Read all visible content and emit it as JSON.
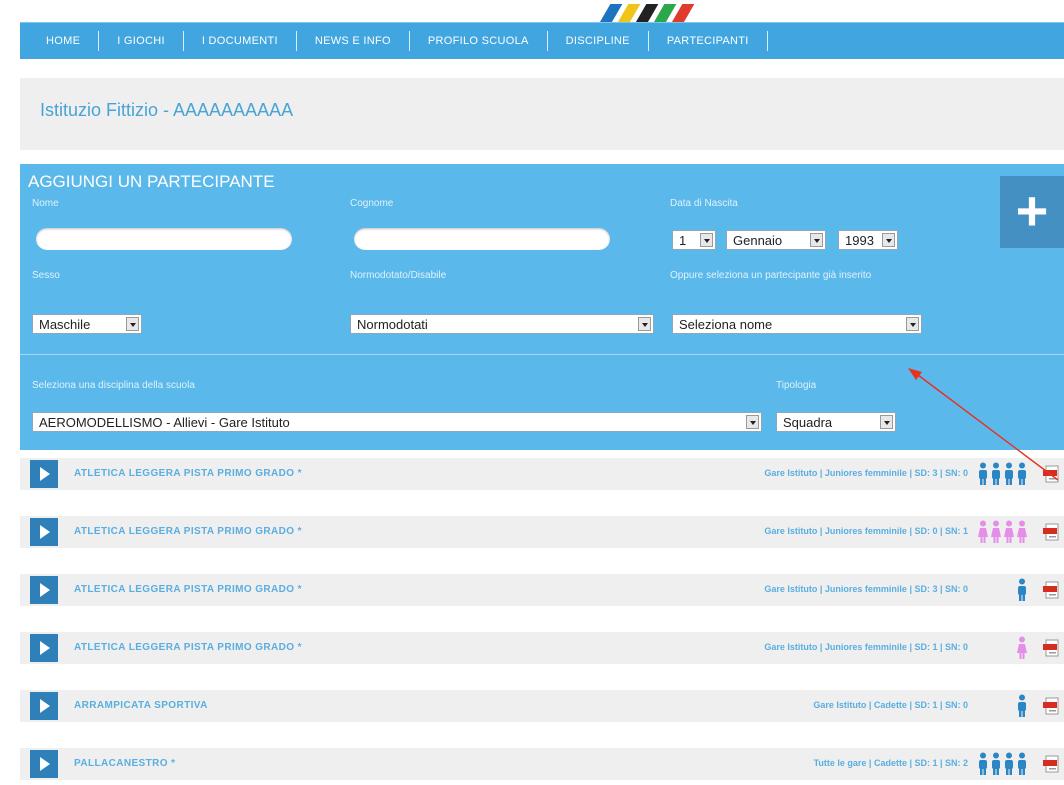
{
  "nav": {
    "items": [
      "HOME",
      "I GIOCHI",
      "I DOCUMENTI",
      "NEWS E INFO",
      "PROFILO SCUOLA",
      "DISCIPLINE",
      "PARTECIPANTI"
    ]
  },
  "school": {
    "title": "Istituzio Fittizio - AAAAAAAAAA"
  },
  "form": {
    "title": "AGGIUNGI UN PARTECIPANTE",
    "nome_label": "Nome",
    "cognome_label": "Cognome",
    "data_label": "Data di Nascita",
    "day": "1",
    "month": "Gennaio",
    "year": "1993",
    "sesso_label": "Sesso",
    "sesso_value": "Maschile",
    "normo_label": "Normodotato/Disabile",
    "normo_value": "Normodotati",
    "oppure_label": "Oppure seleziona un partecipante già inserito",
    "nome_select_value": "Seleziona nome",
    "disciplina_label": "Seleziona una disciplina della scuola",
    "disciplina_value": "AEROMODELLISMO - Allievi - Gare Istituto",
    "tipologia_label": "Tipologia",
    "tipologia_value": "Squadra",
    "plus": "+"
  },
  "colors": {
    "accent": "#5bb8ea",
    "nav": "#41a5e0",
    "male": "#2a86c4",
    "female": "#e58ee8"
  },
  "rows": [
    {
      "name": "ATLETICA LEGGERA PISTA PRIMO GRADO *",
      "info": "Gare Istituto | Juniores femminile | SD: 3 | SN: 0",
      "people": 4,
      "gender": "male"
    },
    {
      "name": "ATLETICA LEGGERA PISTA PRIMO GRADO *",
      "info": "Gare Istituto | Juniores femminile | SD: 0 | SN: 1",
      "people": 4,
      "gender": "female"
    },
    {
      "name": "ATLETICA LEGGERA PISTA PRIMO GRADO *",
      "info": "Gare Istituto | Juniores femminile | SD: 3 | SN: 0",
      "people": 1,
      "gender": "male"
    },
    {
      "name": "ATLETICA LEGGERA PISTA PRIMO GRADO *",
      "info": "Gare Istituto | Juniores femminile | SD: 1 | SN: 0",
      "people": 1,
      "gender": "female"
    },
    {
      "name": "ARRAMPICATA SPORTIVA",
      "info": "Gare Istituto | Cadette | SD: 1 | SN: 0",
      "people": 1,
      "gender": "male"
    },
    {
      "name": "PALLACANESTRO *",
      "info": "Tutte le gare | Cadette | SD: 1 | SN: 2",
      "people": 4,
      "gender": "male"
    }
  ]
}
